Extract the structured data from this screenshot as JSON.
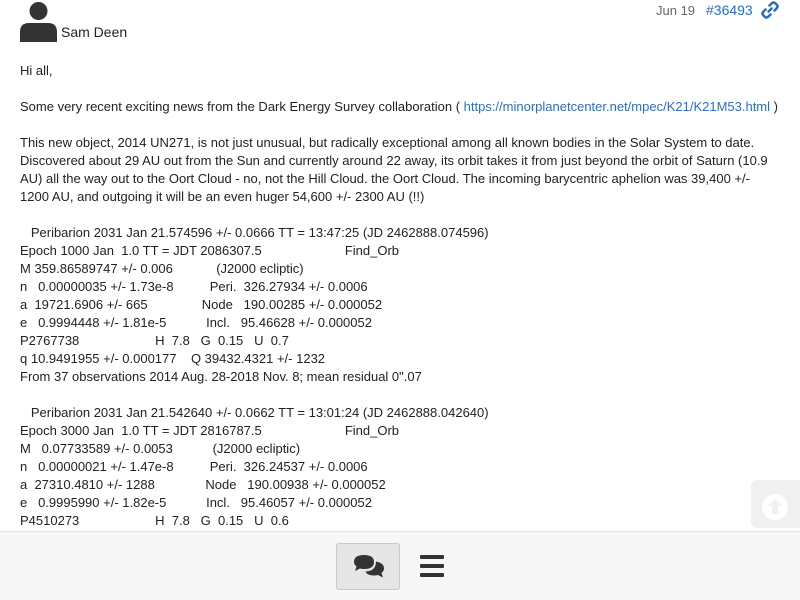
{
  "post": {
    "author": "Sam Deen",
    "date": "Jun 19",
    "message_number": "#36493"
  },
  "icons": {
    "avatar": "user-avatar-icon",
    "permalink": "link-icon",
    "scroll_up": "arrow-circle-up-icon",
    "topics": "chat-bubbles-icon",
    "menu": "hamburger-menu-icon"
  },
  "colors": {
    "link": "#2a6fc2",
    "text": "#222222",
    "muted": "#666666"
  },
  "body": {
    "greeting": "Hi all,",
    "intro_before": "Some very recent exciting news from the Dark Energy Survey collaboration ( ",
    "intro_link": "https://minorplanetcenter.net/mpec/K21/K21M53.html",
    "intro_after": " )",
    "paragraph": "This new object, 2014 UN271, is not just unusual, but radically exceptional among all known bodies in the Solar System to date. Discovered about 29 AU out from the Sun and currently around 22 away, its orbit takes it from just beyond the orbit of Saturn (10.9 AU) all the way out to the Oort Cloud - no, not the Hill Cloud. the Oort Cloud. The incoming barycentric aphelion was 39,400 +/- 1200 AU, and outgoing it will be an even huger 54,600 +/- 2300 AU (!!)",
    "orbit1": [
      "   Peribarion 2031 Jan 21.574596 +/- 0.0666 TT = 13:47:25 (JD 2462888.074596)",
      "Epoch 1000 Jan  1.0 TT = JDT 2086307.5                       Find_Orb",
      "M 359.86589747 +/- 0.006            (J2000 ecliptic)",
      "n   0.00000035 +/- 1.73e-8          Peri.  326.27934 +/- 0.0006",
      "a  19721.6906 +/- 665               Node   190.00285 +/- 0.000052",
      "e   0.9994448 +/- 1.81e-5           Incl.   95.46628 +/- 0.000052",
      "P2767738                     H  7.8   G  0.15   U  0.7",
      "q 10.9491955 +/- 0.000177    Q 39432.4321 +/- 1232",
      "From 37 observations 2014 Aug. 28-2018 Nov. 8; mean residual 0\".07"
    ],
    "orbit2": [
      "   Peribarion 2031 Jan 21.542640 +/- 0.0662 TT = 13:01:24 (JD 2462888.042640)",
      "Epoch 3000 Jan  1.0 TT = JDT 2816787.5                       Find_Orb",
      "M   0.07733589 +/- 0.0053           (J2000 ecliptic)",
      "n   0.00000021 +/- 1.47e-8          Peri.  326.24537 +/- 0.0006",
      "a  27310.4810 +/- 1288              Node   190.00938 +/- 0.000052",
      "e   0.9995990 +/- 1.82e-5           Incl.   95.46057 +/- 0.000052",
      "P4510273                     H  7.8   G  0.15   U  0.6"
    ]
  }
}
